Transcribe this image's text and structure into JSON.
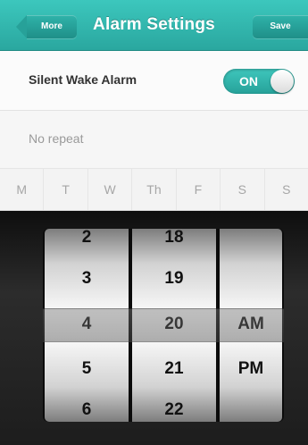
{
  "nav": {
    "back_label": "More",
    "title": "Alarm Settings",
    "save_label": "Save"
  },
  "silent_wake": {
    "label": "Silent Wake Alarm",
    "toggle_label": "ON",
    "toggle_on": true
  },
  "repeat": {
    "label": "No repeat"
  },
  "days": [
    "M",
    "T",
    "W",
    "Th",
    "F",
    "S",
    "S"
  ],
  "picker": {
    "hours": [
      "2",
      "3",
      "4",
      "5",
      "6"
    ],
    "minutes": [
      "18",
      "19",
      "20",
      "21",
      "22"
    ],
    "meridiem": [
      "AM",
      "PM"
    ],
    "selected": {
      "hour": "4",
      "minute": "20",
      "meridiem": "AM"
    }
  },
  "colors": {
    "accent": "#2fb3aa",
    "picker_background": "#1a1a1a"
  }
}
